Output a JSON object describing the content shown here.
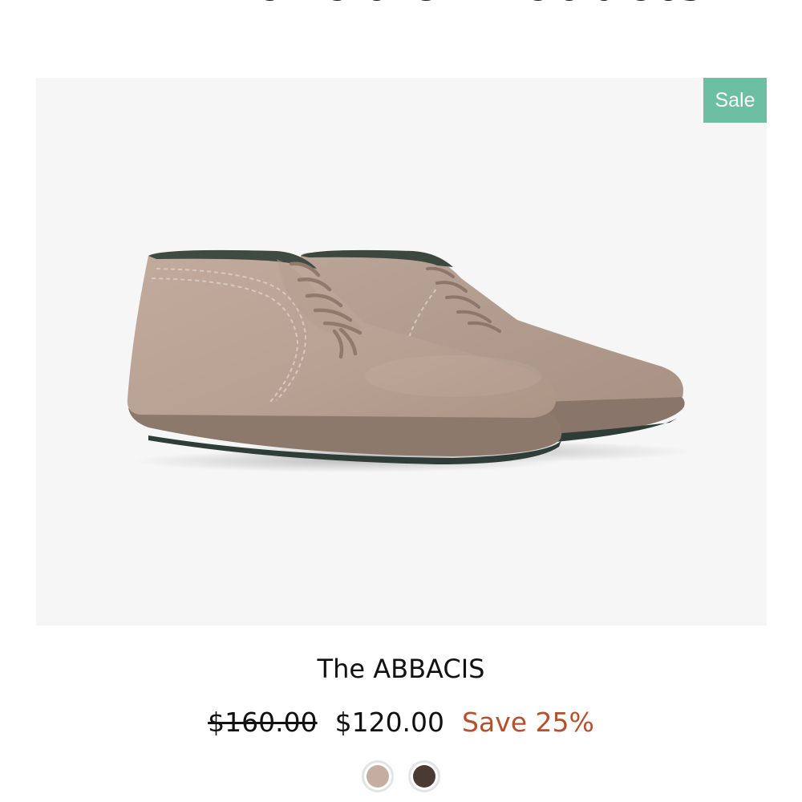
{
  "heading": "All Available Products",
  "product": {
    "badge": "Sale",
    "title": "The ABBACIS",
    "price_original": "$160.00",
    "price_sale": "$120.00",
    "savings": "Save 25%",
    "image_icon": "suede-chukka-boot",
    "swatches": [
      {
        "color": "#c5ada1"
      },
      {
        "color": "#4a3a33"
      }
    ]
  },
  "colors": {
    "badge": "#6dbfa3",
    "savings": "#b4502f",
    "image_background": "#f6f6f6"
  }
}
